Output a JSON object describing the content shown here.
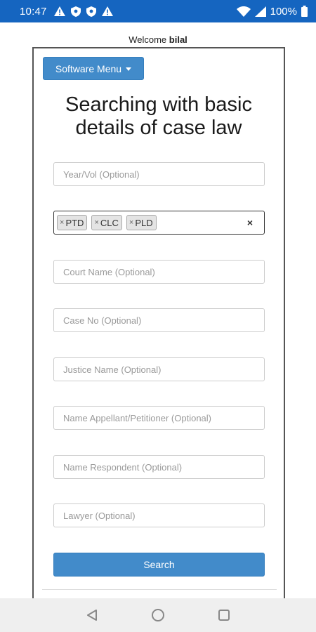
{
  "status_bar": {
    "time": "10:47",
    "battery": "100%",
    "icons": [
      "warning-icon",
      "shield-icon",
      "shield-icon",
      "warning-icon",
      "wifi-icon",
      "signal-icon",
      "battery-icon"
    ]
  },
  "welcome": {
    "prefix": "Welcome",
    "user": "bilal"
  },
  "menu": {
    "software_menu_label": "Software Menu"
  },
  "page": {
    "title": "Searching with basic details of case law"
  },
  "form": {
    "year_vol_placeholder": "Year/Vol (Optional)",
    "journals": {
      "selected": [
        "PTD",
        "CLC",
        "PLD"
      ],
      "remove_glyph": "×",
      "clear_glyph": "×"
    },
    "court_name_placeholder": "Court Name (Optional)",
    "case_no_placeholder": "Case No (Optional)",
    "justice_name_placeholder": "Justice Name (Optional)",
    "appellant_placeholder": "Name Appellant/Petitioner (Optional)",
    "respondent_placeholder": "Name Respondent (Optional)",
    "lawyer_placeholder": "Lawyer (Optional)",
    "search_label": "Search"
  },
  "colors": {
    "status_bar": "#1565c0",
    "primary_button": "#428bca",
    "nav_bar": "#efefef"
  }
}
